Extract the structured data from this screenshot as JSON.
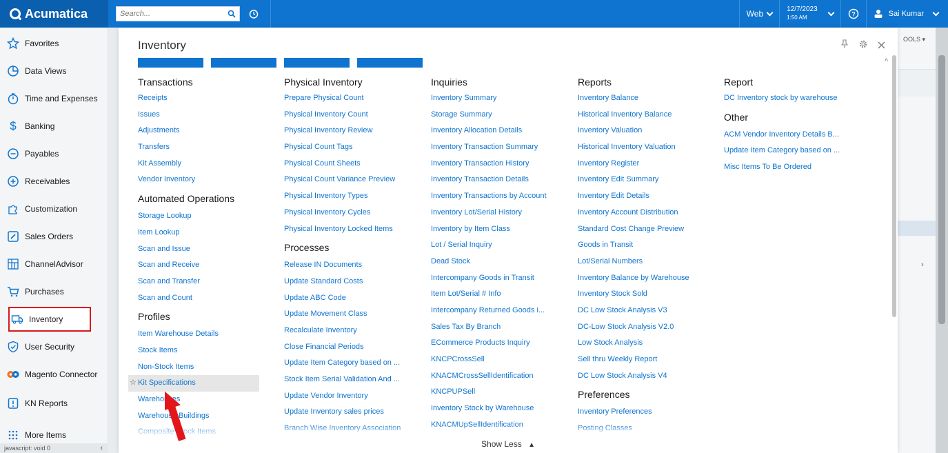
{
  "topbar": {
    "brand": "Acumatica",
    "search_placeholder": "Search...",
    "web_label": "Web",
    "date": "12/7/2023",
    "time": "1:50 AM",
    "user": "Sai Kumar"
  },
  "sidebar": {
    "items": [
      {
        "label": "Favorites",
        "icon": "star-icon"
      },
      {
        "label": "Data Views",
        "icon": "pie-chart-icon"
      },
      {
        "label": "Time and Expenses",
        "icon": "stopwatch-icon"
      },
      {
        "label": "Banking",
        "icon": "dollar-icon"
      },
      {
        "label": "Payables",
        "icon": "minus-circle-icon"
      },
      {
        "label": "Receivables",
        "icon": "plus-circle-icon"
      },
      {
        "label": "Customization",
        "icon": "puzzle-icon"
      },
      {
        "label": "Sales Orders",
        "icon": "edit-box-icon"
      },
      {
        "label": "ChannelAdvisor",
        "icon": "grid-chart-icon"
      },
      {
        "label": "Purchases",
        "icon": "cart-icon"
      },
      {
        "label": "Inventory",
        "icon": "truck-icon"
      },
      {
        "label": "User Security",
        "icon": "shield-icon"
      },
      {
        "label": "Magento Connector",
        "icon": "magento-icon"
      },
      {
        "label": "KN Reports",
        "icon": "report-icon"
      },
      {
        "label": "More Items",
        "icon": "dots-grid-icon"
      }
    ],
    "status_text": "javascript: void 0"
  },
  "panel": {
    "title": "Inventory",
    "show_less": "Show Less",
    "columns": [
      {
        "sections": [
          {
            "header": "Transactions",
            "links": [
              "Receipts",
              "Issues",
              "Adjustments",
              "Transfers",
              "Kit Assembly",
              "Vendor Inventory"
            ]
          },
          {
            "header": "Automated Operations",
            "links": [
              "Storage Lookup",
              "Item Lookup",
              "Scan and Issue",
              "Scan and Receive",
              "Scan and Transfer",
              "Scan and Count"
            ]
          },
          {
            "header": "Profiles",
            "links": [
              "Item Warehouse Details",
              "Stock Items",
              "Non-Stock Items",
              "Kit Specifications",
              "Warehouses",
              "Warehouse Buildings",
              "Composite Stock Items"
            ]
          }
        ]
      },
      {
        "sections": [
          {
            "header": "Physical Inventory",
            "links": [
              "Prepare Physical Count",
              "Physical Inventory Count",
              "Physical Inventory Review",
              "Physical Count Tags",
              "Physical Count Sheets",
              "Physical Count Variance Preview",
              "Physical Inventory Types",
              "Physical Inventory Cycles",
              "Physical Inventory Locked Items"
            ]
          },
          {
            "header": "Processes",
            "links": [
              "Release IN Documents",
              "Update Standard Costs",
              "Update ABC Code",
              "Update Movement Class",
              "Recalculate Inventory",
              "Close Financial Periods",
              "Update Item Category based on ...",
              "Stock Item Serial Validation And ...",
              "Update Vendor Inventory",
              "Update Inventory sales prices",
              "Branch Wise Inventory Association"
            ]
          }
        ]
      },
      {
        "sections": [
          {
            "header": "Inquiries",
            "links": [
              "Inventory Summary",
              "Storage Summary",
              "Inventory Allocation Details",
              "Inventory Transaction Summary",
              "Inventory Transaction History",
              "Inventory Transaction Details",
              "Inventory Transactions by Account",
              "Inventory Lot/Serial History",
              "Inventory by Item Class",
              "Lot / Serial Inquiry",
              "Dead Stock",
              "Intercompany Goods in Transit",
              "Item Lot/Serial # Info",
              "Intercompany Returned Goods i...",
              "Sales Tax By Branch",
              "ECommerce Products Inquiry",
              "KNCPCrossSell",
              "KNACMCrossSellIdentification",
              "KNCPUPSell",
              "Inventory Stock by Warehouse",
              "KNACMUpSellIdentification"
            ]
          }
        ]
      },
      {
        "sections": [
          {
            "header": "Reports",
            "links": [
              "Inventory Balance",
              "Historical Inventory Balance",
              "Inventory Valuation",
              "Historical Inventory Valuation",
              "Inventory Register",
              "Inventory Edit Summary",
              "Inventory Edit Details",
              "Inventory Account Distribution",
              "Standard Cost Change Preview",
              "Goods in Transit",
              "Lot/Serial Numbers",
              "Inventory Balance by Warehouse",
              "Inventory Stock Sold",
              "DC Low Stock Analysis V3",
              "DC-Low Stock Analysis V2.0",
              "Low Stock Analysis",
              "Sell thru Weekly Report",
              "DC Low Stock Analysis V4"
            ]
          },
          {
            "header": "Preferences",
            "links": [
              "Inventory Preferences",
              "Posting Classes"
            ]
          }
        ]
      },
      {
        "sections": [
          {
            "header": "Report",
            "links": [
              "DC Inventory stock by warehouse"
            ]
          },
          {
            "header": "Other",
            "links": [
              "ACM Vendor Inventory Details B...",
              "Update Item Category based on ...",
              "Misc Items To Be Ordered"
            ]
          }
        ]
      }
    ]
  },
  "background": {
    "tools_label": "OOLS"
  },
  "colors": {
    "brand_blue": "#0e74cf",
    "highlight_red": "#d6191b",
    "arrow_red": "#e3161b"
  }
}
